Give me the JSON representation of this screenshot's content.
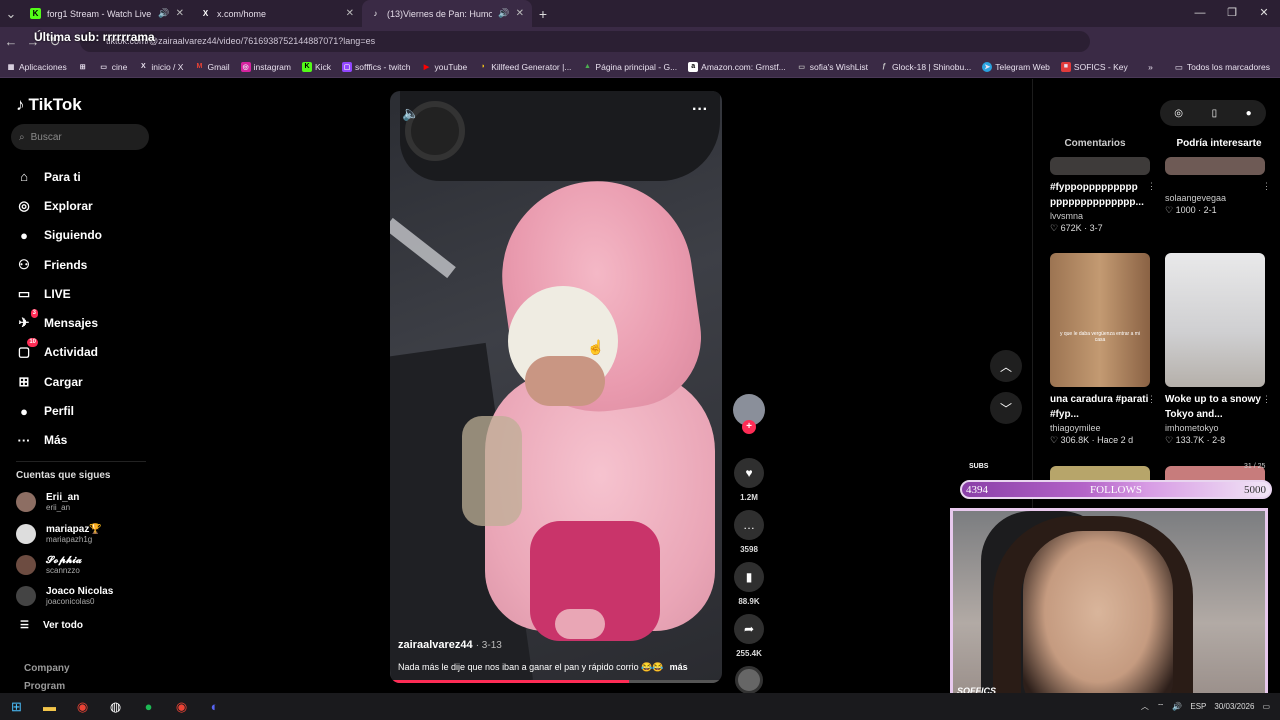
{
  "browser": {
    "tabs": [
      {
        "title": "forg1 Stream - Watch Live o",
        "favicon": "K",
        "favicon_color": "#53fc18"
      },
      {
        "title": "x.com/home",
        "favicon": "X",
        "favicon_color": "#ffffff"
      },
      {
        "title": "(13)Viernes de Pan: Humor",
        "favicon": "♪",
        "favicon_color": "#ffffff"
      }
    ],
    "url": "tiktok.com/@zairaalvarez44/video/7616938752144887071?lang=es",
    "stream_overlay": "Última sub: rrrrrrama",
    "bookmarks": [
      "Aplicaciones",
      "cine",
      "inicio / X",
      "Gmail",
      "instagram",
      "Kick",
      "sofffics - twitch",
      "youTube",
      "Killfeed Generator |...",
      "Página principal - G...",
      "Amazon.com: Grnstf...",
      "sofia's WishList",
      "Glock-18 | Shinobu...",
      "Telegram Web",
      "SOFICS - Key"
    ],
    "bookmarks_right": "Todos los marcadores"
  },
  "tiktok": {
    "logo": "TikTok",
    "search_placeholder": "Buscar",
    "nav": [
      {
        "label": "Para ti",
        "icon": "home-icon",
        "glyph": "⌂"
      },
      {
        "label": "Explorar",
        "icon": "compass-icon",
        "glyph": "◎"
      },
      {
        "label": "Siguiendo",
        "icon": "following-avatar-icon",
        "glyph": "●"
      },
      {
        "label": "Friends",
        "icon": "friends-icon",
        "glyph": "⚇"
      },
      {
        "label": "LIVE",
        "icon": "live-icon",
        "glyph": "▭"
      },
      {
        "label": "Mensajes",
        "icon": "messages-icon",
        "glyph": "✈",
        "badge": "3"
      },
      {
        "label": "Actividad",
        "icon": "activity-icon",
        "glyph": "▢",
        "badge": "10"
      },
      {
        "label": "Cargar",
        "icon": "upload-icon",
        "glyph": "⊞"
      },
      {
        "label": "Perfil",
        "icon": "profile-icon",
        "glyph": "●"
      },
      {
        "label": "Más",
        "icon": "more-icon",
        "glyph": "···"
      }
    ],
    "following_header": "Cuentas que sigues",
    "following": [
      {
        "name": "Erii_an",
        "handle": "erii_an"
      },
      {
        "name": "mariapaz🏆",
        "handle": "mariapazh1g"
      },
      {
        "name": "𝓢𝓸𝓹𝓱𝓲𝓪",
        "handle": "scannzzo"
      },
      {
        "name": "Joaco Nicolas",
        "handle": "joaconicolas0"
      }
    ],
    "see_all": "Ver todo",
    "footer": [
      "Company",
      "Program"
    ]
  },
  "video": {
    "author": "zairaalvarez44",
    "date": "· 3-13",
    "description": "Nada más le dije que nos iban a ganar el pan y rápido corrio 😂😂",
    "more": "más",
    "progress": 0.72,
    "likes": "1.2M",
    "comments": "3598",
    "saves": "88.9K",
    "shares": "255.4K"
  },
  "right_panel": {
    "tabs": [
      "Comentarios",
      "Podría interesarte"
    ],
    "active_tab": 1,
    "cards": [
      {
        "title": "#fyppoppppppppp pppppppppppppp...",
        "user": "lvvsmna",
        "meta": "♡ 672K · 3-7"
      },
      {
        "title": "",
        "user": "solaangevegaa",
        "meta": "♡ 1000 · 2-1"
      },
      {
        "title": "una caradura #parati #fyp...",
        "user": "thiagoymilee",
        "meta": "♡ 306.8K · Hace 2 d"
      },
      {
        "title": "Woke up to a snowy Tokyo and...",
        "user": "imhometokyo",
        "meta": "♡ 133.7K · 2-8"
      }
    ],
    "thumb_caption": "y que le daba vergüenza entrar a mi casa"
  },
  "stream": {
    "subs_label": "SUBS",
    "subs_count": "31 / 25",
    "follows_label": "FOLLOWS",
    "follows_current": "4394",
    "follows_goal": "5000",
    "cam_label": "SOFFICS"
  },
  "taskbar": {
    "lang": "ESP",
    "date": "30/03/2026"
  }
}
